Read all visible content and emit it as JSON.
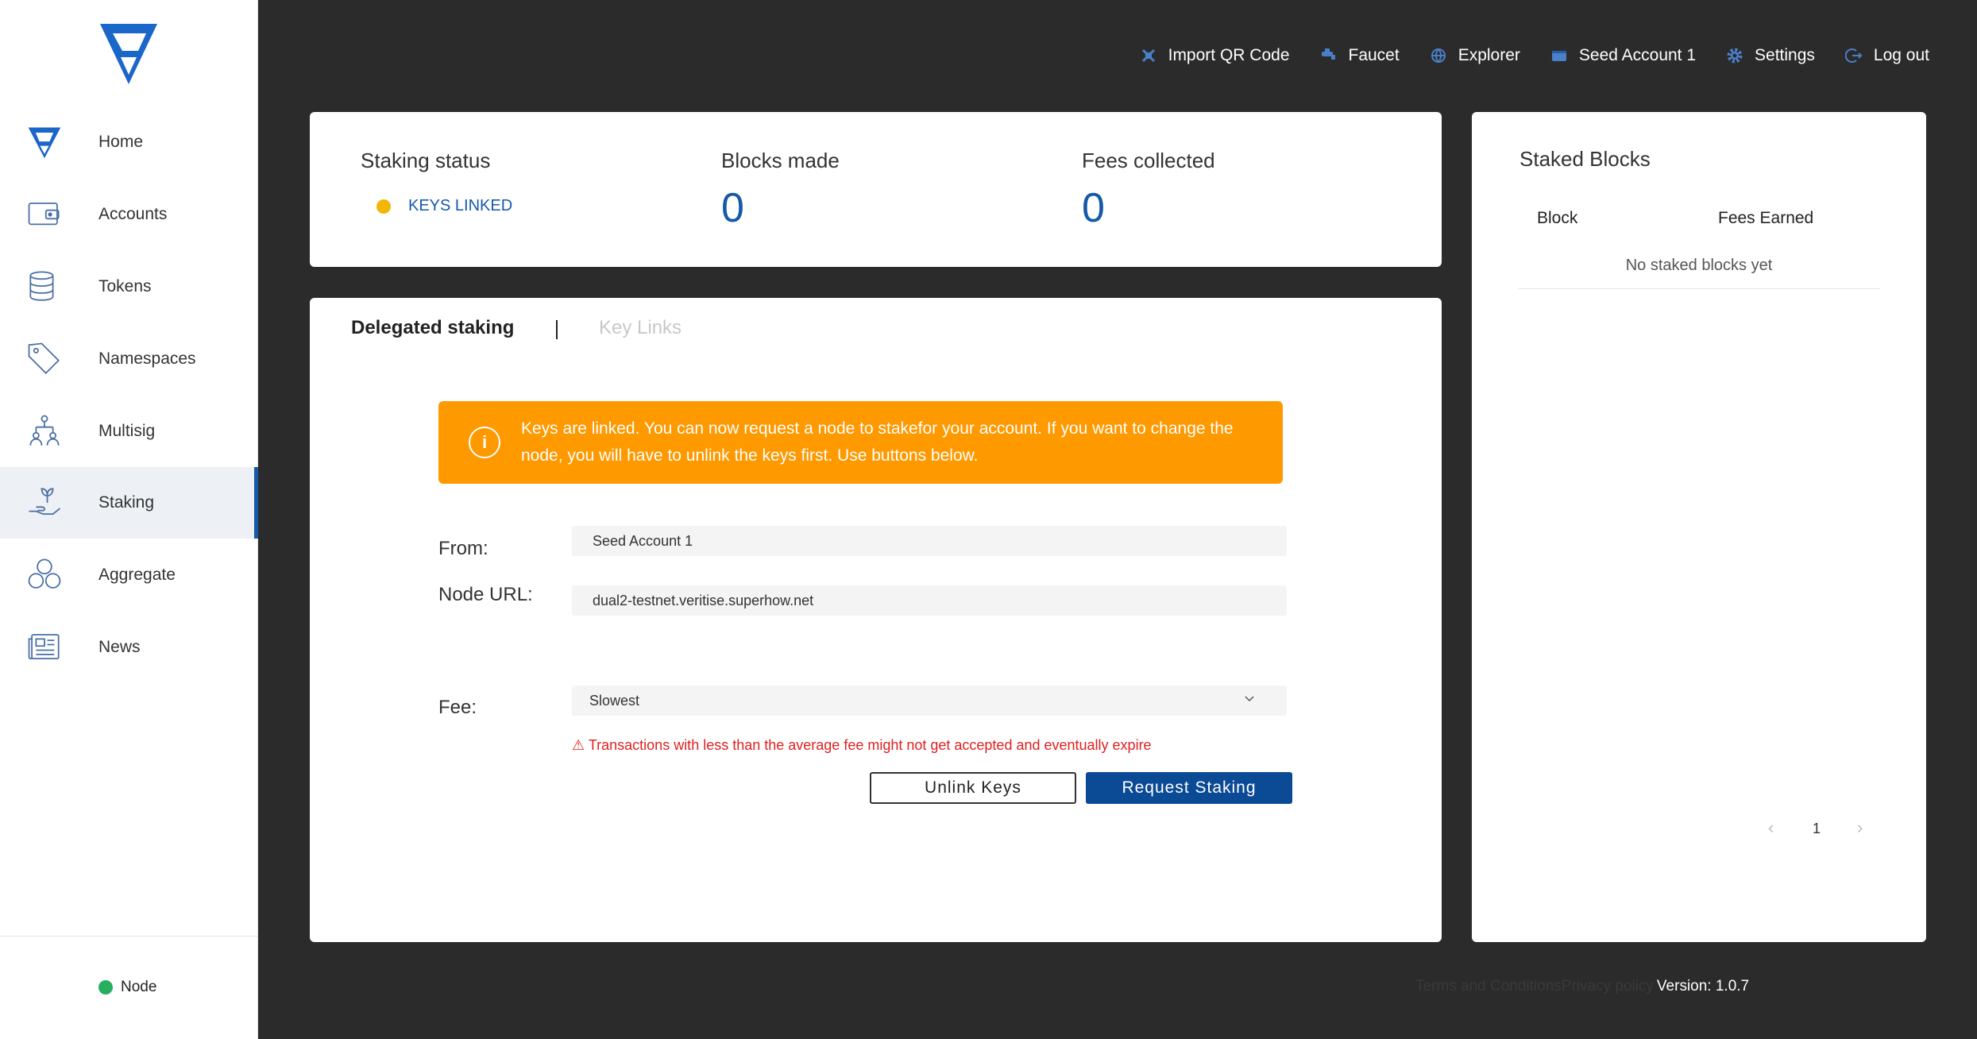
{
  "sidebar": {
    "items": [
      {
        "label": "Home",
        "icon": "home-logo-icon"
      },
      {
        "label": "Accounts",
        "icon": "wallet-icon"
      },
      {
        "label": "Tokens",
        "icon": "coins-icon"
      },
      {
        "label": "Namespaces",
        "icon": "tag-icon"
      },
      {
        "label": "Multisig",
        "icon": "multisig-icon"
      },
      {
        "label": "Staking",
        "icon": "staking-icon"
      },
      {
        "label": "Aggregate",
        "icon": "aggregate-icon"
      },
      {
        "label": "News",
        "icon": "news-icon"
      }
    ],
    "active_item": "Staking",
    "node_label": "Node"
  },
  "topbar": {
    "import_qr": "Import QR Code",
    "faucet": "Faucet",
    "explorer": "Explorer",
    "account": "Seed Account 1",
    "settings": "Settings",
    "logout": "Log out"
  },
  "status": {
    "staking_title": "Staking status",
    "staking_value": "KEYS LINKED",
    "blocks_title": "Blocks made",
    "blocks_value": "0",
    "fees_title": "Fees collected",
    "fees_value": "0"
  },
  "tabs": {
    "active": "Delegated staking",
    "inactive": "Key Links"
  },
  "alert": {
    "text": "Keys are linked. You can now request a node to stakefor your account. If you want to change the node, you will have to unlink the keys first. Use buttons below."
  },
  "form": {
    "from_label": "From:",
    "from_value": "Seed Account 1",
    "node_label": "Node URL:",
    "node_value": "dual2-testnet.veritise.superhow.net",
    "fee_label": "Fee:",
    "fee_value": "Slowest",
    "warning": "⚠ Transactions with less than the average fee might not get accepted and eventually expire",
    "unlink_button": "Unlink Keys",
    "request_button": "Request Staking"
  },
  "staked_blocks": {
    "title": "Staked Blocks",
    "col_block": "Block",
    "col_fees": "Fees Earned",
    "empty": "No staked blocks yet",
    "page": "1",
    "prev": "‹",
    "next": "›"
  },
  "footer": {
    "terms": "Terms and Conditions",
    "privacy": "Privacy policy",
    "version": "Version: 1.0.7"
  },
  "colors": {
    "brand_blue": "#1559a9",
    "alert_orange": "#ff9900",
    "linked_yellow": "#f2b705",
    "node_green": "#27ae60",
    "warning_red": "#e02020"
  }
}
